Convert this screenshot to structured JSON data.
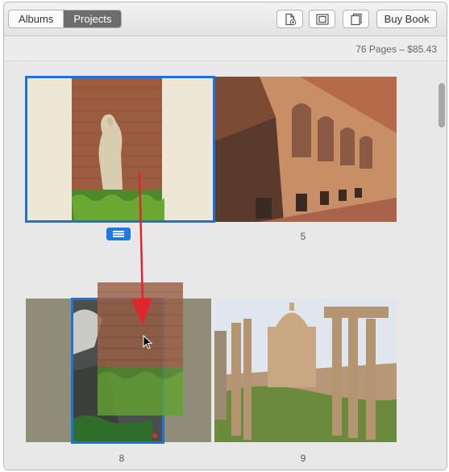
{
  "toolbar": {
    "tabs": [
      {
        "label": "Albums",
        "active": false
      },
      {
        "label": "Projects",
        "active": true
      }
    ],
    "buttons": [
      {
        "name": "add-page-button",
        "icon": "add-page-icon"
      },
      {
        "name": "layout-button",
        "icon": "layout-icon"
      },
      {
        "name": "book-settings-button",
        "icon": "book-icon"
      }
    ],
    "buy_label": "Buy Book"
  },
  "info": {
    "summary": "76 Pages – $85.43"
  },
  "spreads": [
    {
      "pages": [
        {
          "number": "",
          "content": "headless marble statue in front of brick wall, cream side margins",
          "selected": true
        },
        {
          "number": "5",
          "content": "Colosseum interior arches and brick ruins"
        }
      ]
    },
    {
      "pages": [
        {
          "number": "8",
          "content": "olive-background page with stone ruins photo",
          "selected": true
        },
        {
          "number": "9",
          "content": "Roman Forum columns with domed church"
        }
      ]
    }
  ],
  "drag": {
    "ghost": "dragged photo of statue and brick wall",
    "arrow_color": "#e0262a"
  },
  "colors": {
    "selection": "#1b73d9",
    "active_tab": "#6d6d6d"
  }
}
